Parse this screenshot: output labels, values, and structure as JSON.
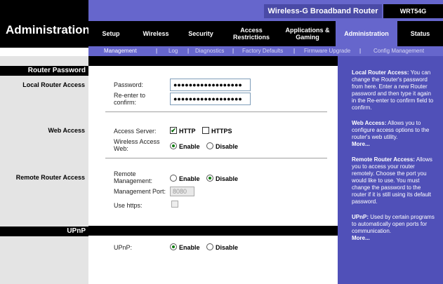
{
  "header": {
    "title": "Administration",
    "product": "Wireless-G Broadband Router",
    "model": "WRT54G"
  },
  "tabs": [
    {
      "label": "Setup"
    },
    {
      "label": "Wireless"
    },
    {
      "label": "Security"
    },
    {
      "label": "Access Restrictions"
    },
    {
      "label": "Applications & Gaming"
    },
    {
      "label": "Administration",
      "active": true
    },
    {
      "label": "Status"
    }
  ],
  "subtabs": [
    "Management",
    "Log",
    "Diagnostics",
    "Factory Defaults",
    "Firmware Upgrade",
    "Config Management"
  ],
  "sections": {
    "router_password": "Router Password",
    "local_access": "Local Router Access",
    "web_access": "Web Access",
    "remote_access": "Remote Router Access",
    "upnp": "UPnP"
  },
  "form": {
    "password_label": "Password:",
    "password_value": "●●●●●●●●●●●●●●●●●●",
    "reenter_label": "Re-enter to confirm:",
    "reenter_value": "●●●●●●●●●●●●●●●●●●",
    "access_server_label": "Access Server:",
    "http_label": "HTTP",
    "https_label": "HTTPS",
    "wireless_web_label": "Wireless Access Web:",
    "enable_label": "Enable",
    "disable_label": "Disable",
    "remote_mgmt_label": "Remote Management:",
    "mgmt_port_label": "Management Port:",
    "mgmt_port_value": "8080",
    "use_https_label": "Use https:",
    "upnp_label": "UPnP:"
  },
  "help": {
    "local_title": "Local Router Access:",
    "local_text": "You can change the Router's password from here. Enter a new Router password and then type it again in the Re-enter to confirm field to confirm.",
    "web_title": "Web Access:",
    "web_text": "Allows you to configure access options to the router's web utility.",
    "more": "More...",
    "remote_title": "Remote Router Access:",
    "remote_text": "Allows you to access your router remotely. Choose the port you would like to use. You must change the password to the router if it is still using its default password.",
    "upnp_title": "UPnP:",
    "upnp_text": "Used by certain programs to automatically open ports for communication."
  },
  "colors": {
    "accent": "#6666cc",
    "help_bg": "#5050b8",
    "black_bar": "#000000"
  }
}
